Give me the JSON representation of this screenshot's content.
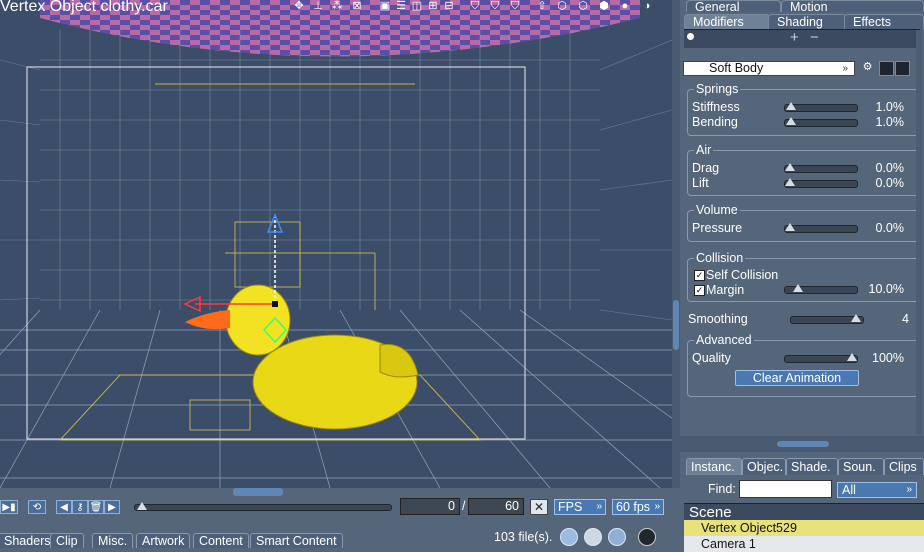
{
  "viewport": {
    "title": "Vertex Object clothy.car"
  },
  "panel": {
    "top_tabs": [
      "General",
      "Motion"
    ],
    "tabs": [
      "Modifiers",
      "Shading",
      "Effects"
    ],
    "add_icon": "+",
    "remove_icon": "−",
    "modifier": "Soft Body",
    "groups": {
      "springs": {
        "label": "Springs",
        "stiffness": {
          "label": "Stiffness",
          "value": "1.0%",
          "level": 0.01
        },
        "bending": {
          "label": "Bending",
          "value": "1.0%",
          "level": 0.01
        }
      },
      "air": {
        "label": "Air",
        "drag": {
          "label": "Drag",
          "value": "0.0%",
          "level": 0.0
        },
        "lift": {
          "label": "Lift",
          "value": "0.0%",
          "level": 0.0
        }
      },
      "volume": {
        "label": "Volume",
        "pressure": {
          "label": "Pressure",
          "value": "0.0%",
          "level": 0.0
        }
      },
      "collision": {
        "label": "Collision",
        "self_collision": {
          "label": "Self Collision",
          "checked": true
        },
        "margin": {
          "label": "Margin",
          "value": "10.0%",
          "level": 0.1,
          "checked": true
        }
      },
      "smoothing": {
        "label": "Smoothing",
        "value": "4"
      },
      "advanced": {
        "label": "Advanced",
        "quality": {
          "label": "Quality",
          "value": "100%",
          "level": 1.0
        },
        "clear_button": "Clear Animation"
      }
    }
  },
  "scene_panel": {
    "tabs": [
      "Instanc.",
      "Objec.",
      "Shade.",
      "Soun.",
      "Clips"
    ],
    "find_label": "Find:",
    "find_value": "",
    "filter": "All",
    "heading": "Scene",
    "items": [
      "Vertex Object529",
      "Camera 1"
    ]
  },
  "timeline": {
    "current_frame": "0",
    "separator": "/",
    "end_frame": "60",
    "mode": "FPS",
    "fps": "60 fps"
  },
  "bottom": {
    "tabs": [
      "Shaders",
      "Clip",
      "Misc.",
      "Artwork",
      "Content",
      "Smart Content"
    ],
    "file_count": "103 file(s)."
  },
  "colors": {
    "viewport_bg": "#3b4d68",
    "panel_bg": "#55657a",
    "duck": "#f0e21a",
    "beak": "#ff6b1a",
    "highlight_row": "#e8e27a"
  }
}
